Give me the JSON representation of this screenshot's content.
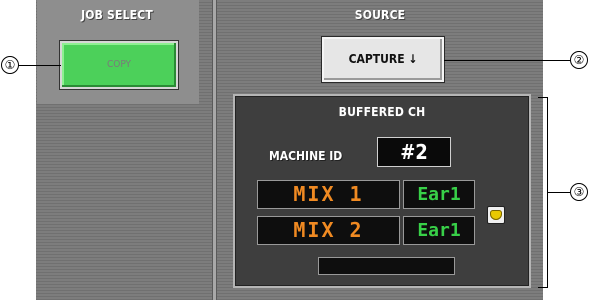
{
  "job_select": {
    "title": "JOB SELECT",
    "button_label": "COPY"
  },
  "source": {
    "title": "SOURCE",
    "button_label": "CAPTURE ↓"
  },
  "buffered_ch": {
    "title": "BUFFERED CH",
    "machine_id_label": "MACHINE ID",
    "machine_id_value": "#2",
    "channels": [
      {
        "name": "MIX 1",
        "port": "Ear1"
      },
      {
        "name": "MIX 2",
        "port": "Ear1"
      }
    ],
    "link_icon": "heart-icon"
  },
  "callouts": [
    "①",
    "②",
    "③"
  ],
  "colors": {
    "copy_button": "#4cd05a",
    "mix_text": "#f08a22",
    "port_text": "#38d048",
    "link_icon": "#e8c800"
  }
}
